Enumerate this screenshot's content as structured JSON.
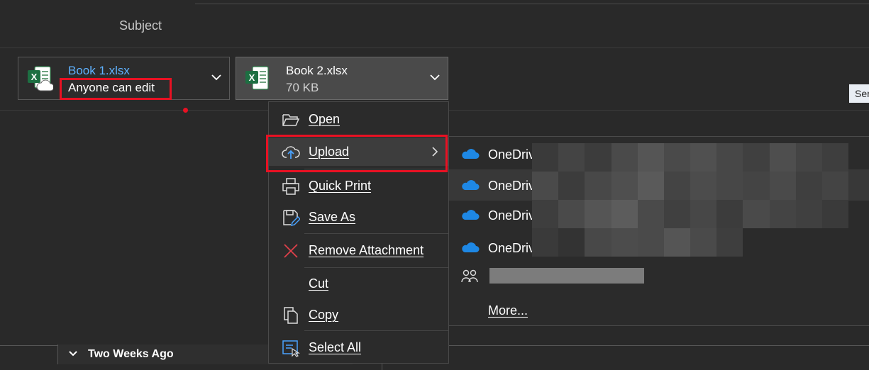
{
  "header": {
    "subject_label": "Subject",
    "send_tip": "Ser"
  },
  "attachments": [
    {
      "name": "Book 1.xlsx",
      "subtitle": "Anyone can edit",
      "icon": "excel-cloud-icon"
    },
    {
      "name": "Book 2.xlsx",
      "subtitle": "70 KB",
      "icon": "excel-icon"
    }
  ],
  "context_menu": {
    "items": [
      {
        "label": "Open",
        "icon": "folder-open-icon"
      },
      {
        "label": "Upload",
        "icon": "cloud-upload-icon"
      },
      {
        "label": "Quick Print",
        "icon": "printer-icon"
      },
      {
        "label": "Save As",
        "icon": "save-as-icon"
      },
      {
        "label": "Remove Attachment",
        "icon": "close-icon"
      },
      {
        "label": "Cut",
        "icon": ""
      },
      {
        "label": "Copy",
        "icon": "copy-icon"
      },
      {
        "label": "Select All",
        "icon": "select-all-icon"
      }
    ]
  },
  "upload_submenu": {
    "items": [
      {
        "label": "OneDriv",
        "icon": "onedrive-icon"
      },
      {
        "label": "OneDriv",
        "icon": "onedrive-icon"
      },
      {
        "label": "OneDriv",
        "icon": "onedrive-icon"
      },
      {
        "label": "OneDriv",
        "icon": "onedrive-icon"
      }
    ],
    "more_label": "More..."
  },
  "list": {
    "group_label": "Two Weeks Ago"
  },
  "colors": {
    "accent_red": "#e81123",
    "onedrive_blue": "#1e88e5",
    "excel_green": "#1d6f42",
    "link_blue": "#5fb2ff"
  }
}
